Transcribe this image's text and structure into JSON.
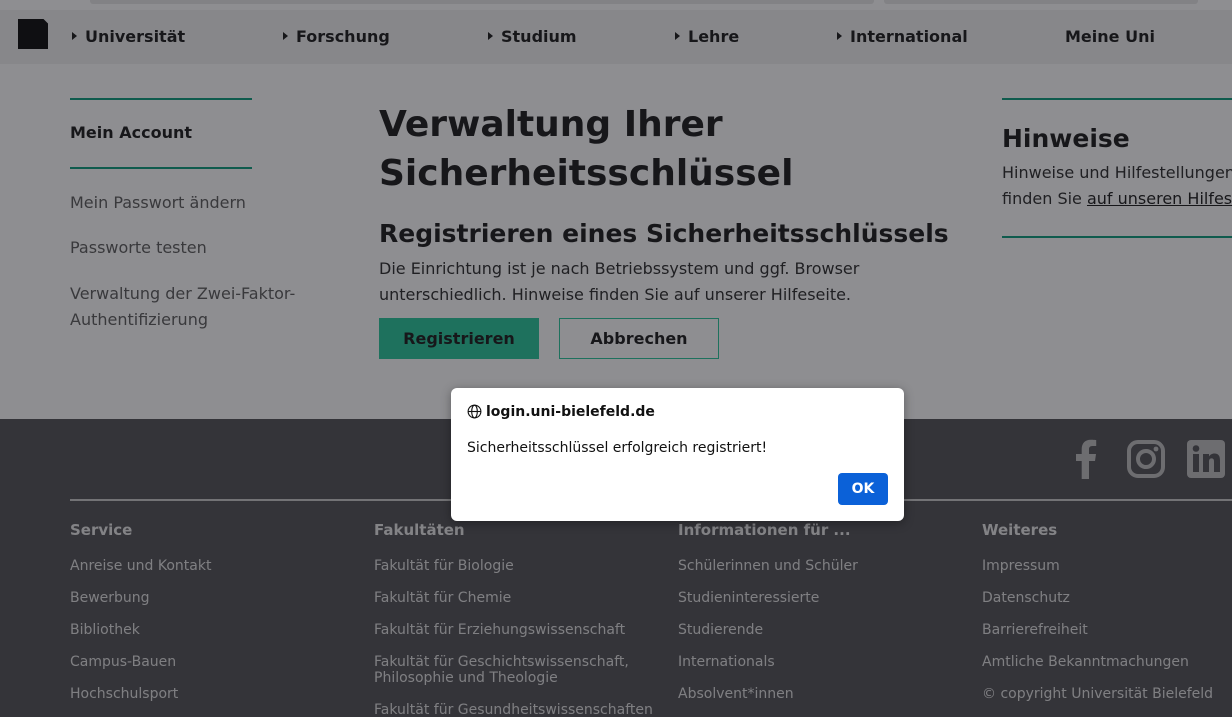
{
  "nav": {
    "items": [
      {
        "label": "Universität",
        "has_arrow": true
      },
      {
        "label": "Forschung",
        "has_arrow": true
      },
      {
        "label": "Studium",
        "has_arrow": true
      },
      {
        "label": "Lehre",
        "has_arrow": true
      },
      {
        "label": "International",
        "has_arrow": true
      },
      {
        "label": "Meine Uni",
        "has_arrow": false
      }
    ]
  },
  "sidebar": {
    "title": "Mein Account",
    "links": [
      {
        "label": "Mein Passwort ändern"
      },
      {
        "label": "Passworte testen"
      },
      {
        "label": "Verwaltung der Zwei-Faktor-Authentifizierung"
      }
    ]
  },
  "main": {
    "title": "Verwaltung Ihrer Sicherheitsschlüssel",
    "subtitle": "Registrieren eines Sicherheitsschlüssels",
    "description": "Die Einrichtung ist je nach Betriebssystem und ggf. Browser unterschiedlich. Hinweise finden Sie auf unserer Hilfeseite.",
    "register_label": "Registrieren",
    "cancel_label": "Abbrechen"
  },
  "hints": {
    "title": "Hinweise",
    "text_line1": "Hinweise und Hilfestellungen",
    "text_line2_prefix": "finden Sie ",
    "link_text": "auf unseren Hilfes"
  },
  "footer": {
    "social_icons": [
      "facebook-icon",
      "instagram-icon",
      "linkedin-icon"
    ],
    "columns": [
      {
        "title": "Service",
        "items": [
          "Anreise und Kontakt",
          "Bewerbung",
          "Bibliothek",
          "Campus-Bauen",
          "Hochschulsport"
        ]
      },
      {
        "title": "Fakultäten",
        "items": [
          "Fakultät für Biologie",
          "Fakultät für Chemie",
          "Fakultät für Erziehungswissenschaft",
          "Fakultät für Geschichtswissenschaft, Philosophie und Theologie",
          "Fakultät für Gesundheitswissenschaften"
        ]
      },
      {
        "title": "Informationen für ...",
        "items": [
          "Schülerinnen und Schüler",
          "Studieninteressierte",
          "Studierende",
          "Internationals",
          "Absolvent*innen"
        ]
      },
      {
        "title": "Weiteres",
        "items": [
          "Impressum",
          "Datenschutz",
          "Barrierefreiheit",
          "Amtliche Bekanntmachungen",
          "© copyright Universität Bielefeld"
        ]
      }
    ]
  },
  "dialog": {
    "origin": "login.uni-bielefeld.de",
    "message": "Sicherheitsschlüssel erfolgreich registriert!",
    "ok_label": "OK"
  },
  "colors": {
    "accent": "#1fc596",
    "accent_line": "#009877",
    "footer_bg": "#4a4a4f",
    "dialog_button": "#0b61d8"
  }
}
